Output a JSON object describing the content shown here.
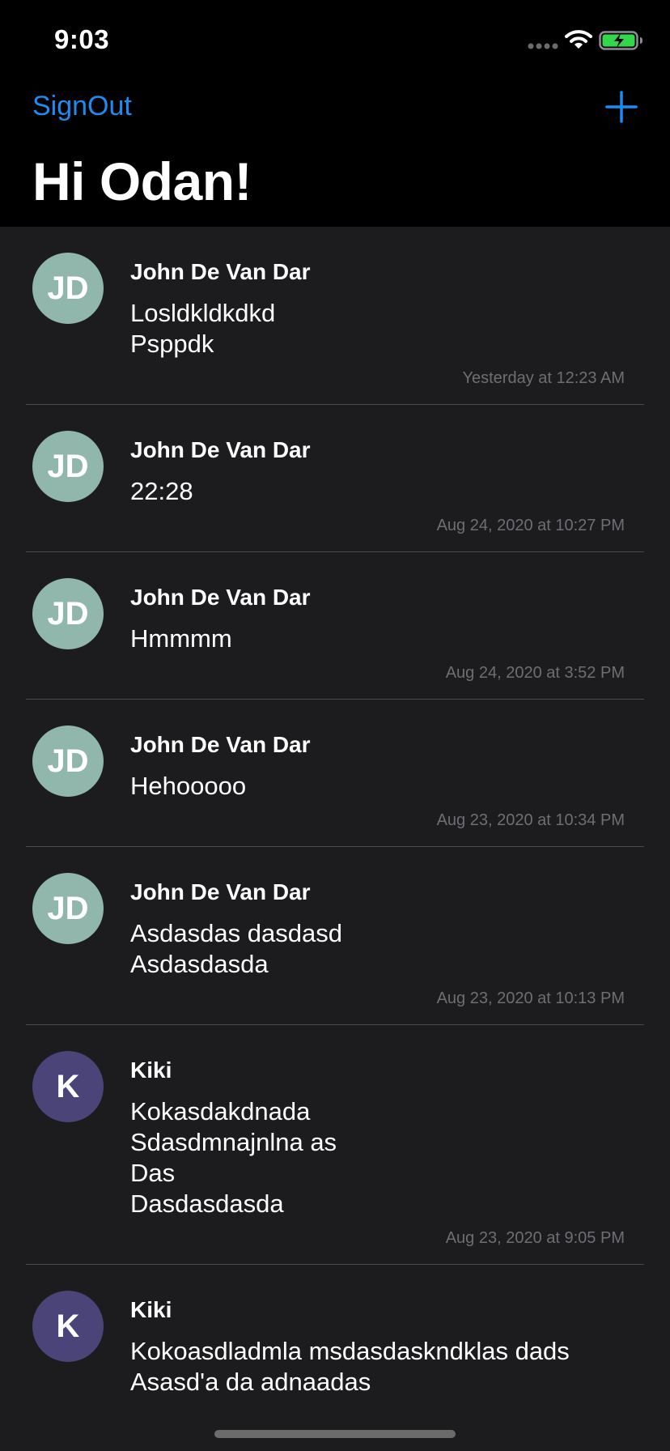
{
  "status_bar": {
    "time": "9:03"
  },
  "nav": {
    "signout_label": "SignOut",
    "add_icon": "plus-icon",
    "title": "Hi Odan!",
    "accent": "#1e8bf0"
  },
  "messages": [
    {
      "initials": "JD",
      "avatar_color": "#91b7ad",
      "name": "John De Van Dar",
      "text": "Losldkldkdkd\nPsppdk",
      "timestamp": "Yesterday at 12:23 AM"
    },
    {
      "initials": "JD",
      "avatar_color": "#91b7ad",
      "name": "John De Van Dar",
      "text": "22:28",
      "timestamp": "Aug 24, 2020 at 10:27 PM"
    },
    {
      "initials": "JD",
      "avatar_color": "#91b7ad",
      "name": "John De Van Dar",
      "text": "Hmmmm",
      "timestamp": "Aug 24, 2020 at 3:52 PM"
    },
    {
      "initials": "JD",
      "avatar_color": "#91b7ad",
      "name": "John De Van Dar",
      "text": "Hehooooo",
      "timestamp": "Aug 23, 2020 at 10:34 PM"
    },
    {
      "initials": "JD",
      "avatar_color": "#91b7ad",
      "name": "John De Van Dar",
      "text": "Asdasdas dasdasd\nAsdasdasda",
      "timestamp": "Aug 23, 2020 at 10:13 PM"
    },
    {
      "initials": "K",
      "avatar_color": "#4b4478",
      "name": "Kiki",
      "text": "Kokasdakdnada\nSdasdmnajnlna as\nDas\nDasdasdasda",
      "timestamp": "Aug 23, 2020 at 9:05 PM"
    },
    {
      "initials": "K",
      "avatar_color": "#4b4478",
      "name": "Kiki",
      "text": "Kokoasdladmla msdasdaskndklas dads\nAsasd'a da adnaadas",
      "timestamp": ""
    }
  ]
}
